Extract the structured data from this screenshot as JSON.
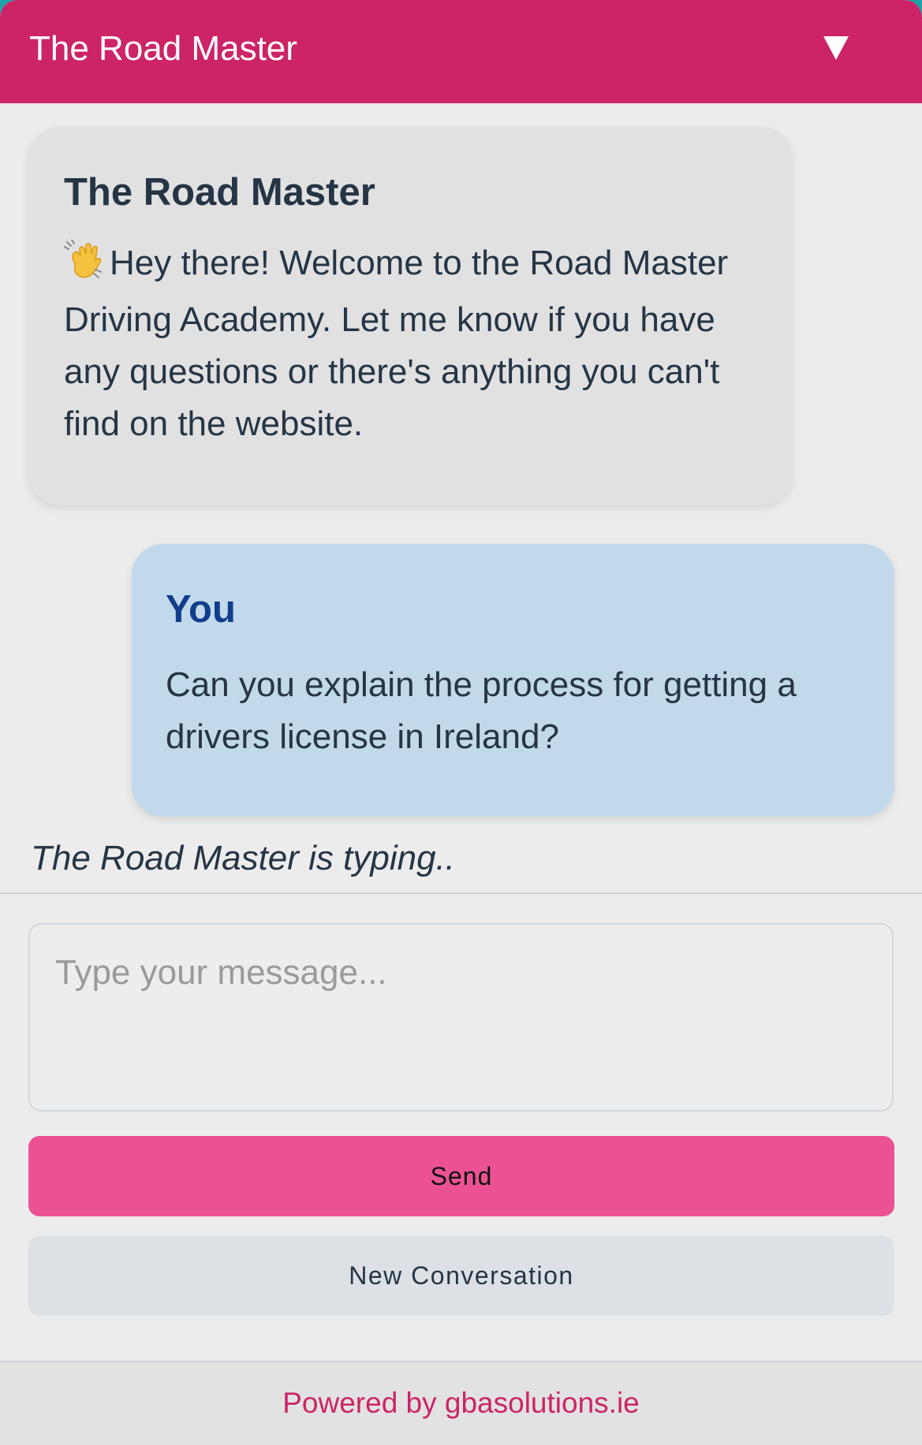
{
  "header": {
    "title": "The Road Master",
    "collapse_icon": "triangle-down-icon"
  },
  "messages": [
    {
      "role": "bot",
      "sender": "The Road Master",
      "icon": "waving-hand-icon",
      "text": "Hey there! Welcome to the Road Master Driving Academy. Let me know if you have any questions or there's anything you can't find on the website."
    },
    {
      "role": "user",
      "sender": "You",
      "text": "Can you explain the process for getting a drivers license in Ireland?"
    }
  ],
  "status": {
    "typing": "The Road Master is typing.."
  },
  "composer": {
    "value": "",
    "placeholder": "Type your message...",
    "send_label": "Send",
    "new_conversation_label": "New Conversation"
  },
  "footer": {
    "powered_by": "Powered by gbasolutions.ie"
  },
  "colors": {
    "brand": "#cc2466",
    "send_button": "#ec5293",
    "bot_bubble": "#e1e1e1",
    "user_bubble": "#c2d9ec",
    "user_name": "#113e8b",
    "text": "#253545"
  }
}
